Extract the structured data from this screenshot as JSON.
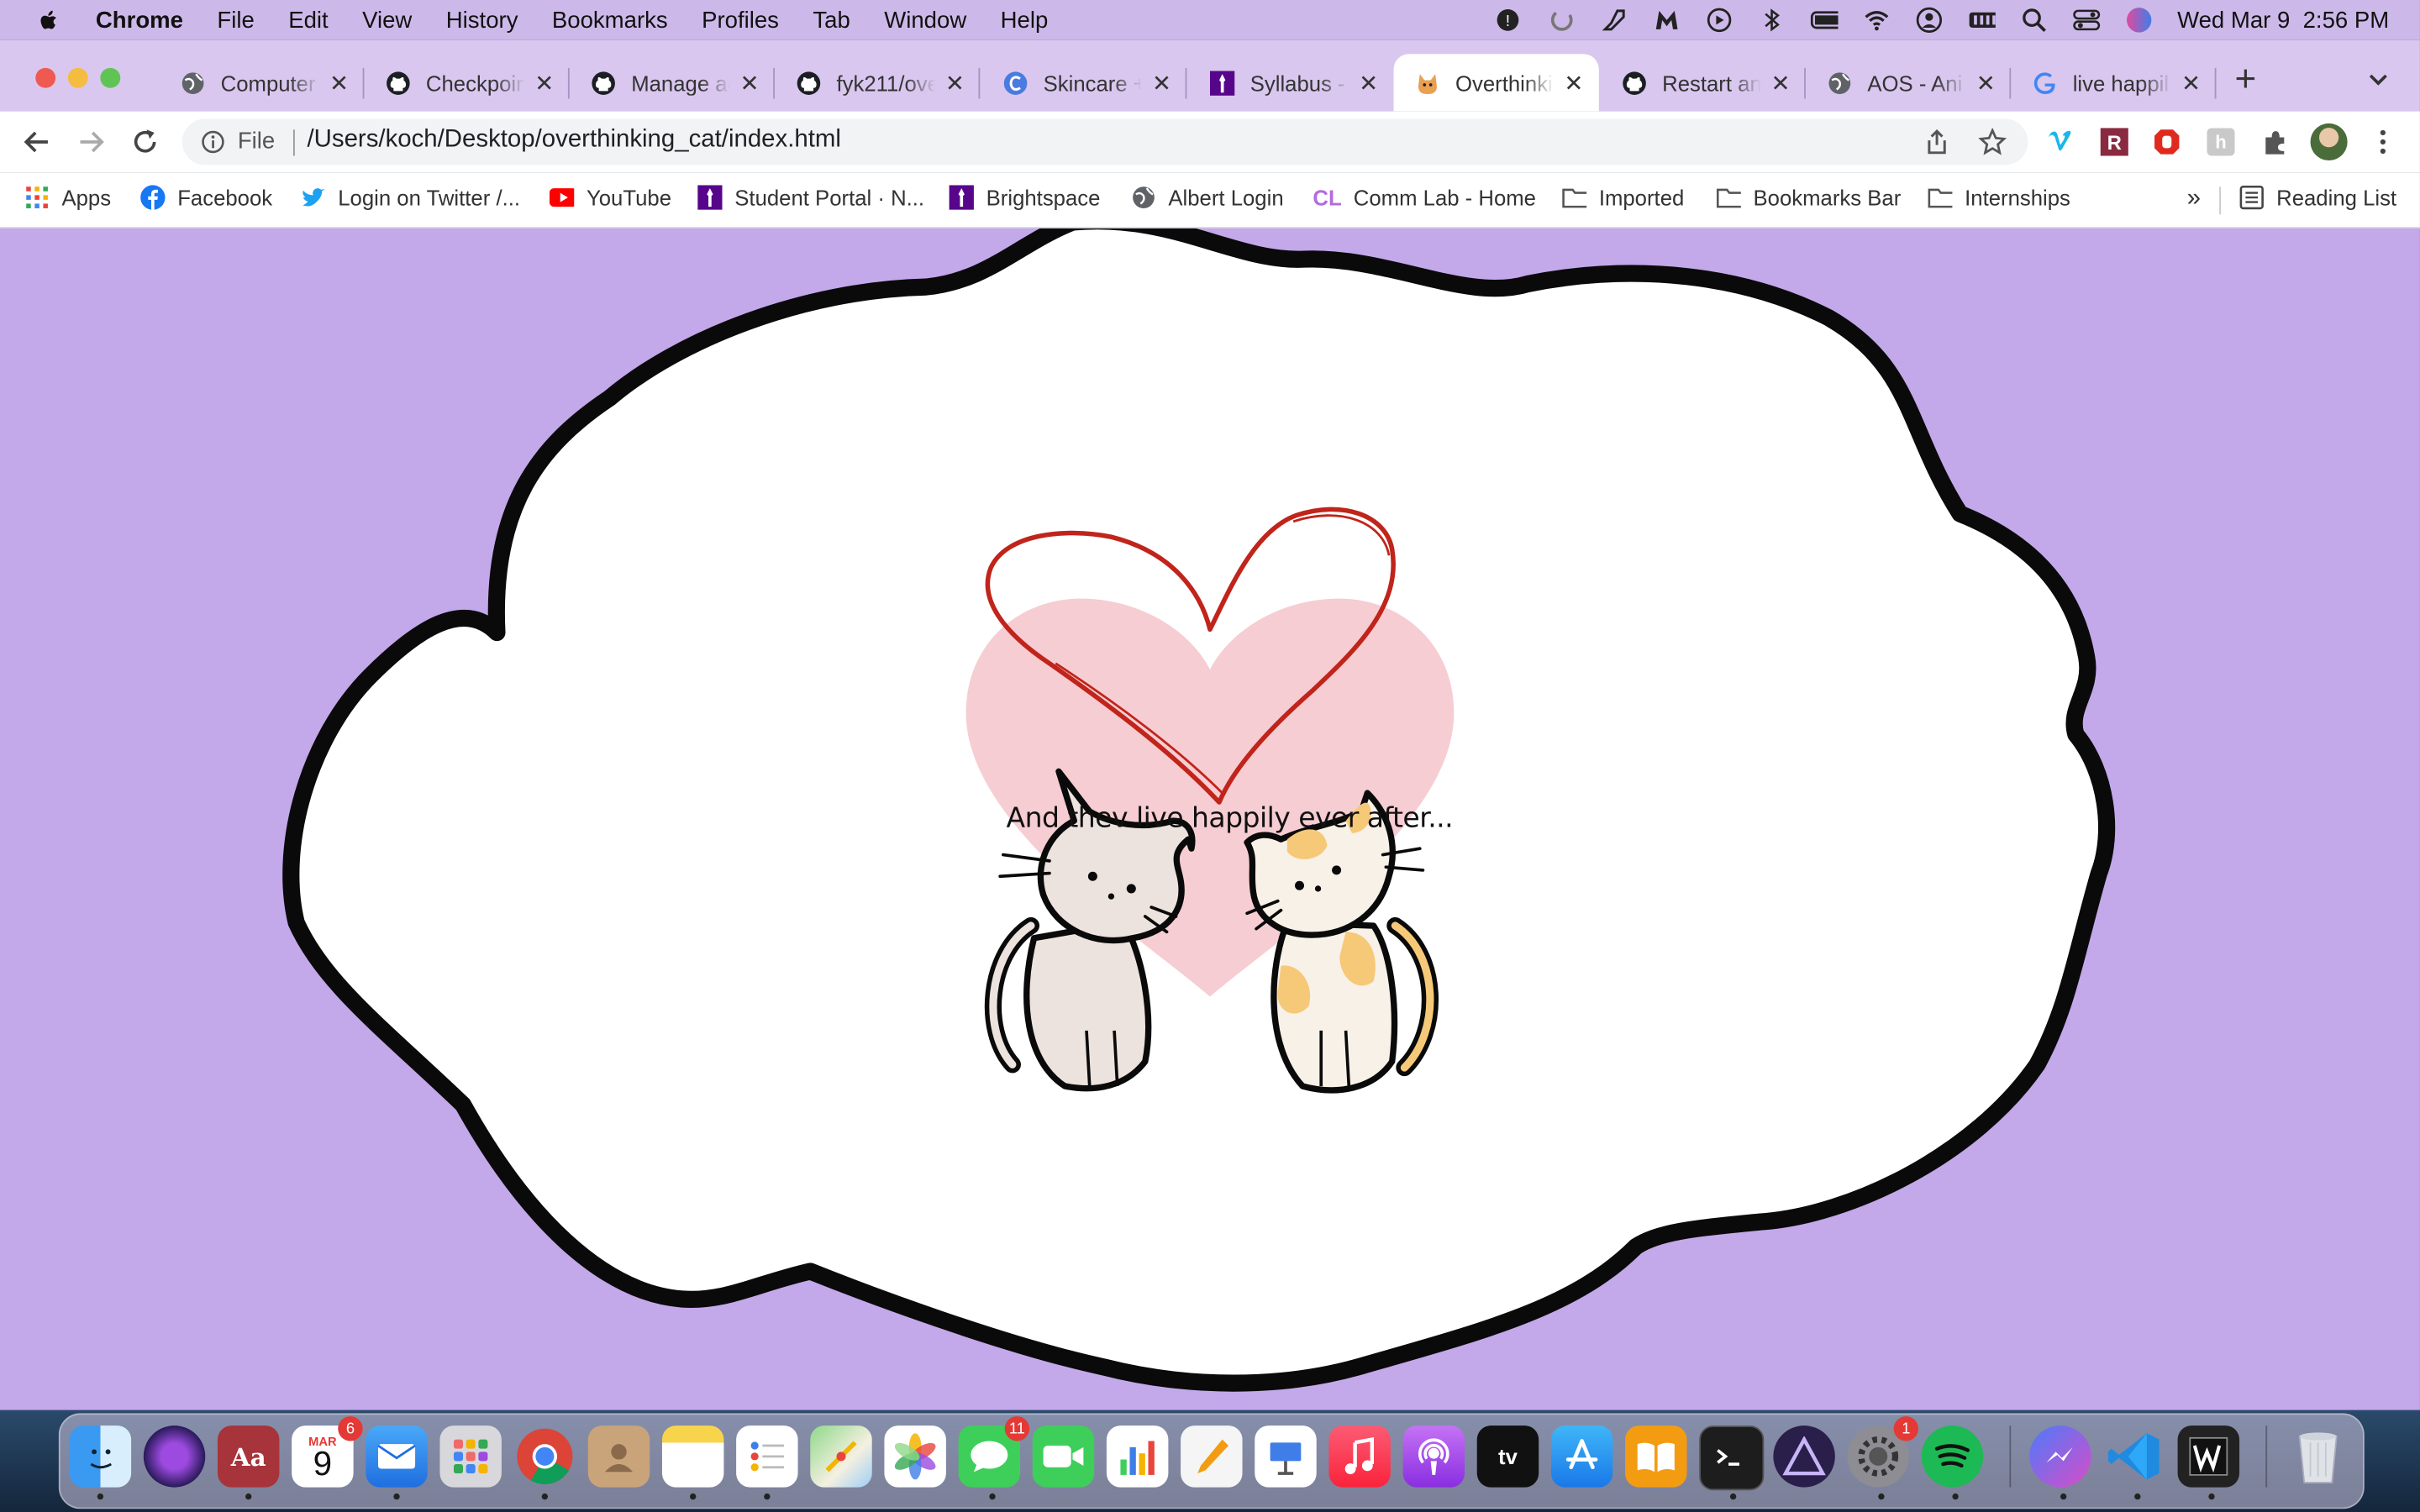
{
  "menubar": {
    "app": "Chrome",
    "items": [
      "File",
      "Edit",
      "View",
      "History",
      "Bookmarks",
      "Profiles",
      "Tab",
      "Window",
      "Help"
    ],
    "clock": "Wed Mar 9  2:56 PM"
  },
  "tabs": [
    {
      "title": "Computer",
      "icon": "globe-icon"
    },
    {
      "title": "Checkpoin",
      "icon": "github-icon"
    },
    {
      "title": "Manage ac",
      "icon": "github-icon"
    },
    {
      "title": "fyk211/ove",
      "icon": "github-icon"
    },
    {
      "title": "Skincare +",
      "icon": "skincare-icon"
    },
    {
      "title": "Syllabus -",
      "icon": "nyu-icon"
    },
    {
      "title": "Overthinki",
      "icon": "cat-icon"
    },
    {
      "title": "Restart an",
      "icon": "github-icon"
    },
    {
      "title": "AOS - Ani",
      "icon": "globe-icon"
    },
    {
      "title": "live happil",
      "icon": "google-icon"
    }
  ],
  "active_tab_index": 6,
  "address": {
    "scheme_label": "File",
    "url": "/Users/koch/Desktop/overthinking_cat/index.html"
  },
  "bookmarks": {
    "apps": "Apps",
    "facebook": "Facebook",
    "twitter": "Login on Twitter /...",
    "youtube": "YouTube",
    "student_portal": "Student Portal · N...",
    "brightspace": "Brightspace",
    "albert": "Albert Login",
    "commlab": "Comm Lab - Home",
    "imported": "Imported",
    "bookmarks_bar": "Bookmarks Bar",
    "internships": "Internships",
    "overflow": "»",
    "reading_list": "Reading List"
  },
  "page": {
    "caption": "And thev live happily ever after...",
    "background": "#c3a8ea",
    "heart_fill": "#f6cdd2",
    "heart_outline": "#c0241a"
  },
  "dock": {
    "calendar_month": "MAR",
    "calendar_day": "9",
    "calendar_badge": "6",
    "messages_badge": "11",
    "settings_badge": "1",
    "dictionary_label": "Aa",
    "tv_label": "tv"
  }
}
